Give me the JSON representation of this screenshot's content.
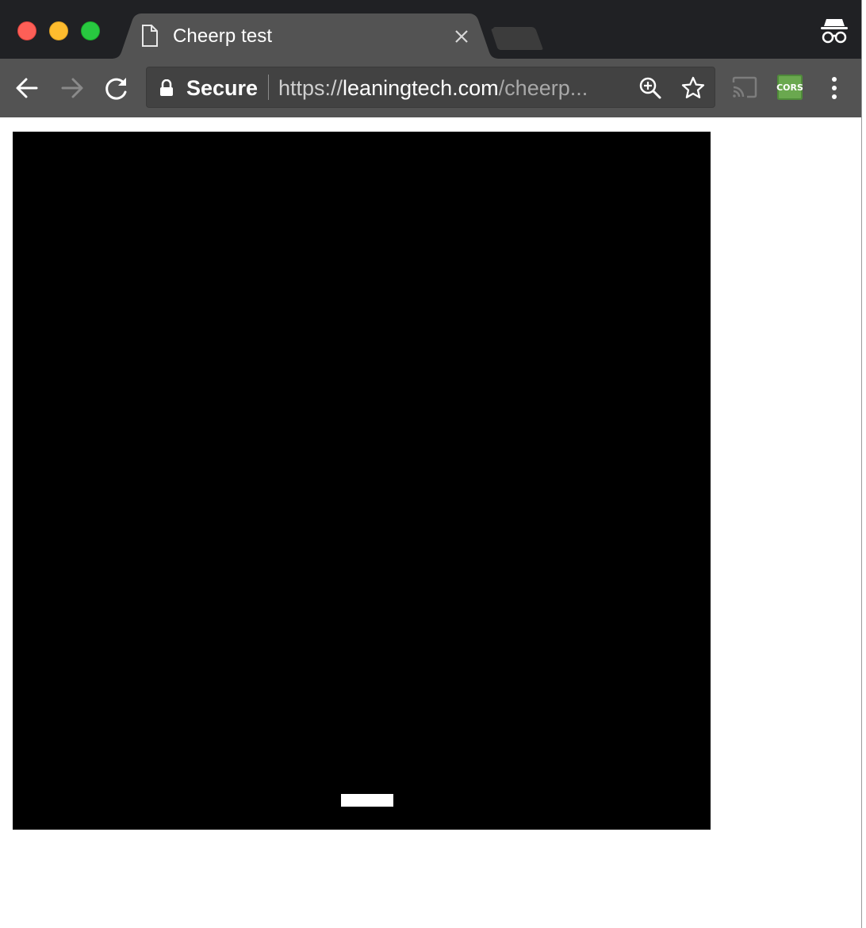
{
  "browser": {
    "tab": {
      "title": "Cheerp test"
    },
    "omnibox": {
      "security_label": "Secure",
      "url_scheme": "https://",
      "url_host": "leaningtech.com",
      "url_path": "/cheerp..."
    },
    "extensions": {
      "cors_label": "CORS"
    }
  },
  "game": {
    "background": "#000000",
    "paddle": {
      "color": "#ffffff",
      "position_fraction": 0.5
    }
  },
  "colors": {
    "titlebar": "#202124",
    "toolbar": "#535353",
    "tab_active": "#535353",
    "cors_green": "#6aa84f"
  }
}
